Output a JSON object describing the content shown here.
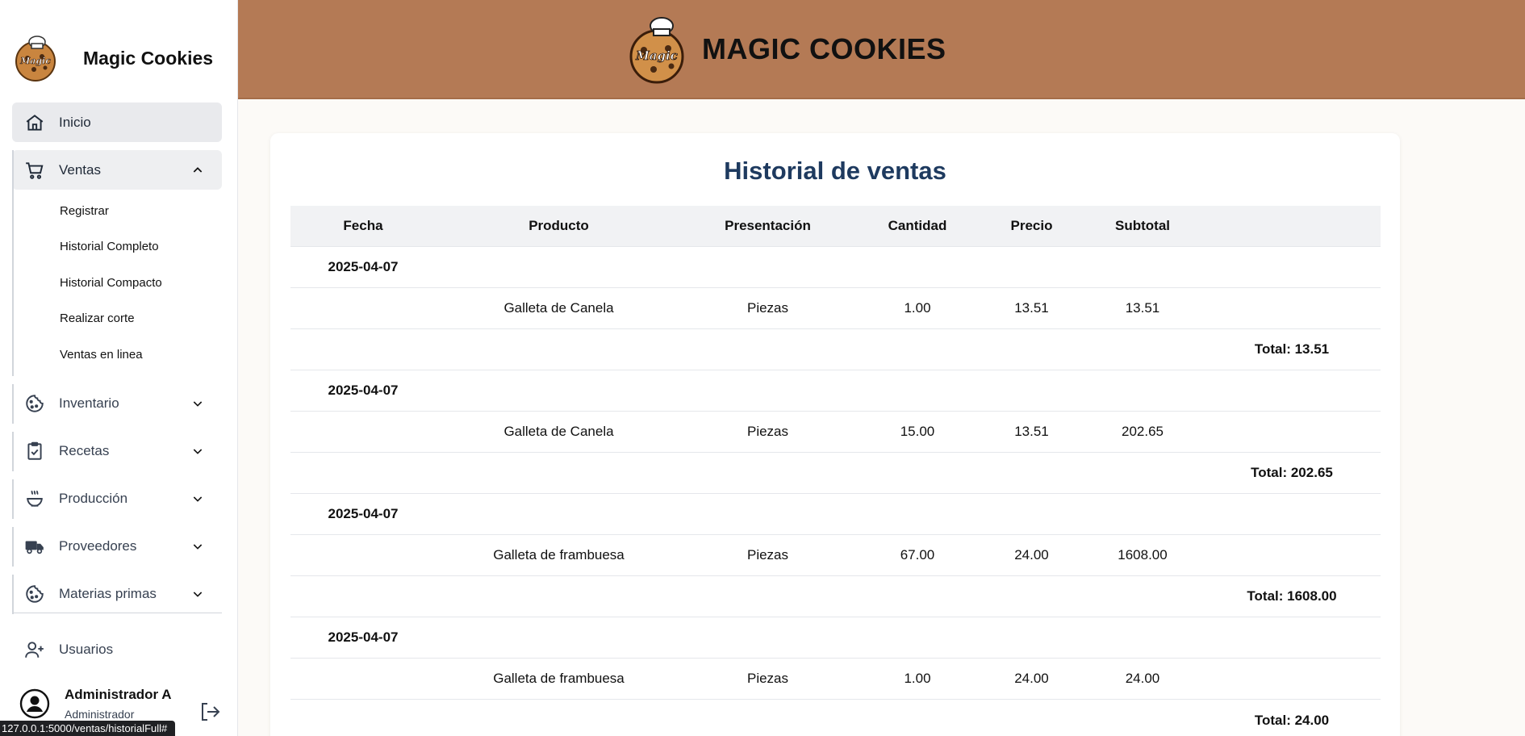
{
  "brand": {
    "name": "Magic Cookies",
    "logo_text": "Magic Cookies"
  },
  "header": {
    "title": "MAGIC COOKIES"
  },
  "sidebar": {
    "inicio": "Inicio",
    "ventas": "Ventas",
    "ventas_sub": [
      "Registrar",
      "Historial Completo",
      "Historial Compacto",
      "Realizar corte",
      "Ventas en linea"
    ],
    "inventario": "Inventario",
    "recetas": "Recetas",
    "produccion": "Producción",
    "proveedores": "Proveedores",
    "materias": "Materias primas",
    "usuarios": "Usuarios"
  },
  "user": {
    "name": "Administrador A",
    "role": "Administrador"
  },
  "status_url": "127.0.0.1:5000/ventas/historialFull#",
  "page": {
    "title": "Historial de ventas"
  },
  "table": {
    "headers": [
      "Fecha",
      "Producto",
      "Presentación",
      "Cantidad",
      "Precio",
      "Subtotal"
    ],
    "groups": [
      {
        "date": "2025-04-07",
        "product": "Galleta de Canela",
        "presentation": "Piezas",
        "qty": "1.00",
        "price": "13.51",
        "subtotal": "13.51",
        "total": "Total: 13.51"
      },
      {
        "date": "2025-04-07",
        "product": "Galleta de Canela",
        "presentation": "Piezas",
        "qty": "15.00",
        "price": "13.51",
        "subtotal": "202.65",
        "total": "Total: 202.65"
      },
      {
        "date": "2025-04-07",
        "product": "Galleta de frambuesa",
        "presentation": "Piezas",
        "qty": "67.00",
        "price": "24.00",
        "subtotal": "1608.00",
        "total": "Total: 1608.00"
      },
      {
        "date": "2025-04-07",
        "product": "Galleta de frambuesa",
        "presentation": "Piezas",
        "qty": "1.00",
        "price": "24.00",
        "subtotal": "24.00",
        "total": "Total: 24.00"
      }
    ]
  }
}
